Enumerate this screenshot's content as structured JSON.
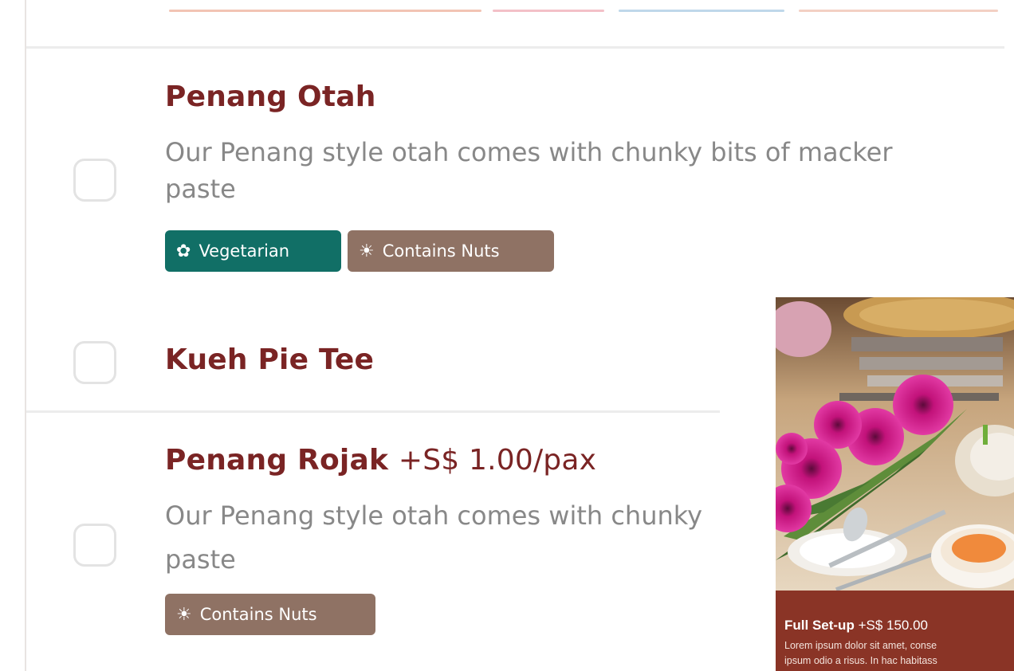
{
  "menu_items": [
    {
      "title": "Penang Otah",
      "description_line1": "Our Penang style otah comes with chunky bits of macker",
      "description_line2": "paste",
      "tags": [
        "Vegetarian",
        "Contains Nuts"
      ]
    },
    {
      "title": "Kueh Pie Tee"
    },
    {
      "title_name": "Penang Rojak",
      "title_price": "+S$ 1.00/pax",
      "description_line1": "Our Penang style otah comes with chunky",
      "description_line2": "paste",
      "tags": [
        "Contains Nuts"
      ]
    }
  ],
  "tag_icons": {
    "vegetarian": "leaf-icon",
    "contains_nuts": "peanut-icon"
  },
  "card": {
    "title": "Full Set-up",
    "price": "+S$ 150.00",
    "text_line1": "Lorem ipsum dolor sit amet, conse",
    "text_line2": "ipsum odio a risus. In hac habitass"
  },
  "colors": {
    "title": "#7a2424",
    "vegetarian_tag": "#116f66",
    "nuts_tag": "#8f7264",
    "card_footer": "#8a3426"
  }
}
